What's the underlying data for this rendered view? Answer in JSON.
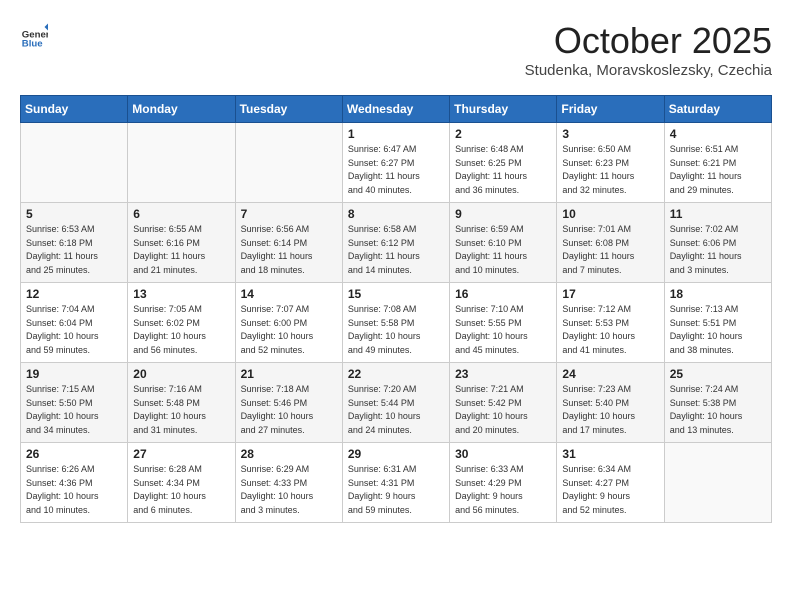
{
  "header": {
    "logo_general": "General",
    "logo_blue": "Blue",
    "month": "October 2025",
    "location": "Studenka, Moravskoslezsky, Czechia"
  },
  "weekdays": [
    "Sunday",
    "Monday",
    "Tuesday",
    "Wednesday",
    "Thursday",
    "Friday",
    "Saturday"
  ],
  "weeks": [
    [
      {
        "day": "",
        "info": ""
      },
      {
        "day": "",
        "info": ""
      },
      {
        "day": "",
        "info": ""
      },
      {
        "day": "1",
        "info": "Sunrise: 6:47 AM\nSunset: 6:27 PM\nDaylight: 11 hours\nand 40 minutes."
      },
      {
        "day": "2",
        "info": "Sunrise: 6:48 AM\nSunset: 6:25 PM\nDaylight: 11 hours\nand 36 minutes."
      },
      {
        "day": "3",
        "info": "Sunrise: 6:50 AM\nSunset: 6:23 PM\nDaylight: 11 hours\nand 32 minutes."
      },
      {
        "day": "4",
        "info": "Sunrise: 6:51 AM\nSunset: 6:21 PM\nDaylight: 11 hours\nand 29 minutes."
      }
    ],
    [
      {
        "day": "5",
        "info": "Sunrise: 6:53 AM\nSunset: 6:18 PM\nDaylight: 11 hours\nand 25 minutes."
      },
      {
        "day": "6",
        "info": "Sunrise: 6:55 AM\nSunset: 6:16 PM\nDaylight: 11 hours\nand 21 minutes."
      },
      {
        "day": "7",
        "info": "Sunrise: 6:56 AM\nSunset: 6:14 PM\nDaylight: 11 hours\nand 18 minutes."
      },
      {
        "day": "8",
        "info": "Sunrise: 6:58 AM\nSunset: 6:12 PM\nDaylight: 11 hours\nand 14 minutes."
      },
      {
        "day": "9",
        "info": "Sunrise: 6:59 AM\nSunset: 6:10 PM\nDaylight: 11 hours\nand 10 minutes."
      },
      {
        "day": "10",
        "info": "Sunrise: 7:01 AM\nSunset: 6:08 PM\nDaylight: 11 hours\nand 7 minutes."
      },
      {
        "day": "11",
        "info": "Sunrise: 7:02 AM\nSunset: 6:06 PM\nDaylight: 11 hours\nand 3 minutes."
      }
    ],
    [
      {
        "day": "12",
        "info": "Sunrise: 7:04 AM\nSunset: 6:04 PM\nDaylight: 10 hours\nand 59 minutes."
      },
      {
        "day": "13",
        "info": "Sunrise: 7:05 AM\nSunset: 6:02 PM\nDaylight: 10 hours\nand 56 minutes."
      },
      {
        "day": "14",
        "info": "Sunrise: 7:07 AM\nSunset: 6:00 PM\nDaylight: 10 hours\nand 52 minutes."
      },
      {
        "day": "15",
        "info": "Sunrise: 7:08 AM\nSunset: 5:58 PM\nDaylight: 10 hours\nand 49 minutes."
      },
      {
        "day": "16",
        "info": "Sunrise: 7:10 AM\nSunset: 5:55 PM\nDaylight: 10 hours\nand 45 minutes."
      },
      {
        "day": "17",
        "info": "Sunrise: 7:12 AM\nSunset: 5:53 PM\nDaylight: 10 hours\nand 41 minutes."
      },
      {
        "day": "18",
        "info": "Sunrise: 7:13 AM\nSunset: 5:51 PM\nDaylight: 10 hours\nand 38 minutes."
      }
    ],
    [
      {
        "day": "19",
        "info": "Sunrise: 7:15 AM\nSunset: 5:50 PM\nDaylight: 10 hours\nand 34 minutes."
      },
      {
        "day": "20",
        "info": "Sunrise: 7:16 AM\nSunset: 5:48 PM\nDaylight: 10 hours\nand 31 minutes."
      },
      {
        "day": "21",
        "info": "Sunrise: 7:18 AM\nSunset: 5:46 PM\nDaylight: 10 hours\nand 27 minutes."
      },
      {
        "day": "22",
        "info": "Sunrise: 7:20 AM\nSunset: 5:44 PM\nDaylight: 10 hours\nand 24 minutes."
      },
      {
        "day": "23",
        "info": "Sunrise: 7:21 AM\nSunset: 5:42 PM\nDaylight: 10 hours\nand 20 minutes."
      },
      {
        "day": "24",
        "info": "Sunrise: 7:23 AM\nSunset: 5:40 PM\nDaylight: 10 hours\nand 17 minutes."
      },
      {
        "day": "25",
        "info": "Sunrise: 7:24 AM\nSunset: 5:38 PM\nDaylight: 10 hours\nand 13 minutes."
      }
    ],
    [
      {
        "day": "26",
        "info": "Sunrise: 6:26 AM\nSunset: 4:36 PM\nDaylight: 10 hours\nand 10 minutes."
      },
      {
        "day": "27",
        "info": "Sunrise: 6:28 AM\nSunset: 4:34 PM\nDaylight: 10 hours\nand 6 minutes."
      },
      {
        "day": "28",
        "info": "Sunrise: 6:29 AM\nSunset: 4:33 PM\nDaylight: 10 hours\nand 3 minutes."
      },
      {
        "day": "29",
        "info": "Sunrise: 6:31 AM\nSunset: 4:31 PM\nDaylight: 9 hours\nand 59 minutes."
      },
      {
        "day": "30",
        "info": "Sunrise: 6:33 AM\nSunset: 4:29 PM\nDaylight: 9 hours\nand 56 minutes."
      },
      {
        "day": "31",
        "info": "Sunrise: 6:34 AM\nSunset: 4:27 PM\nDaylight: 9 hours\nand 52 minutes."
      },
      {
        "day": "",
        "info": ""
      }
    ]
  ]
}
